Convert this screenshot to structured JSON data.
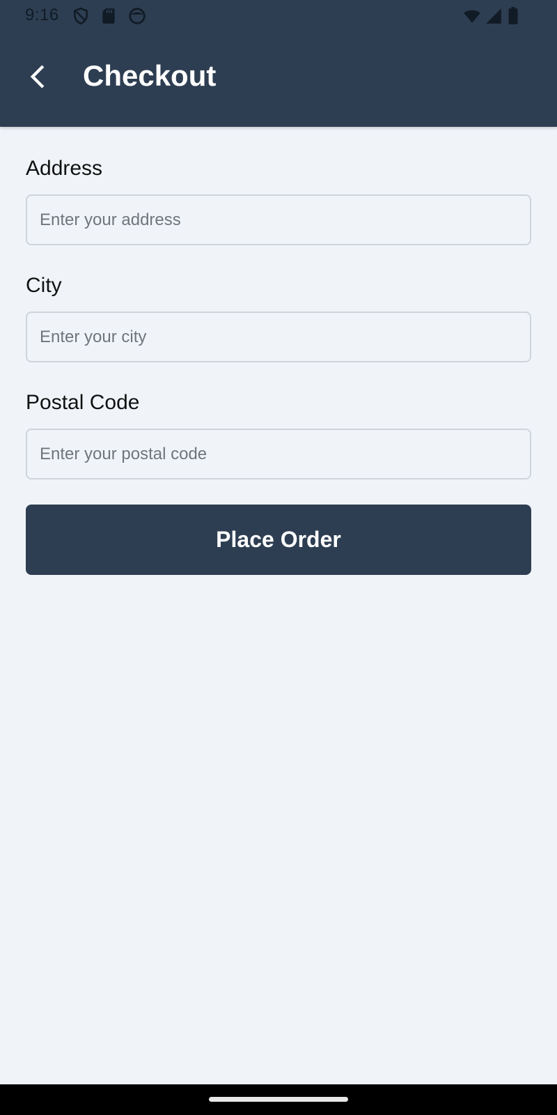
{
  "status_bar": {
    "time": "9:16",
    "left_icons": [
      "shield-icon",
      "sd-card-icon",
      "face-circle-icon"
    ],
    "right_icons": [
      "wifi-icon",
      "cell-signal-icon",
      "battery-icon"
    ]
  },
  "app_bar": {
    "title": "Checkout",
    "back_icon": "chevron-left-icon"
  },
  "form": {
    "address": {
      "label": "Address",
      "placeholder": "Enter your address",
      "value": ""
    },
    "city": {
      "label": "City",
      "placeholder": "Enter your city",
      "value": ""
    },
    "postal_code": {
      "label": "Postal Code",
      "placeholder": "Enter your postal code",
      "value": ""
    }
  },
  "actions": {
    "place_order_label": "Place Order"
  },
  "colors": {
    "primary": "#2e3e52",
    "background": "#f0f4f9",
    "input_border": "#cfd4da",
    "text": "#111111",
    "placeholder": "#6f757c"
  }
}
